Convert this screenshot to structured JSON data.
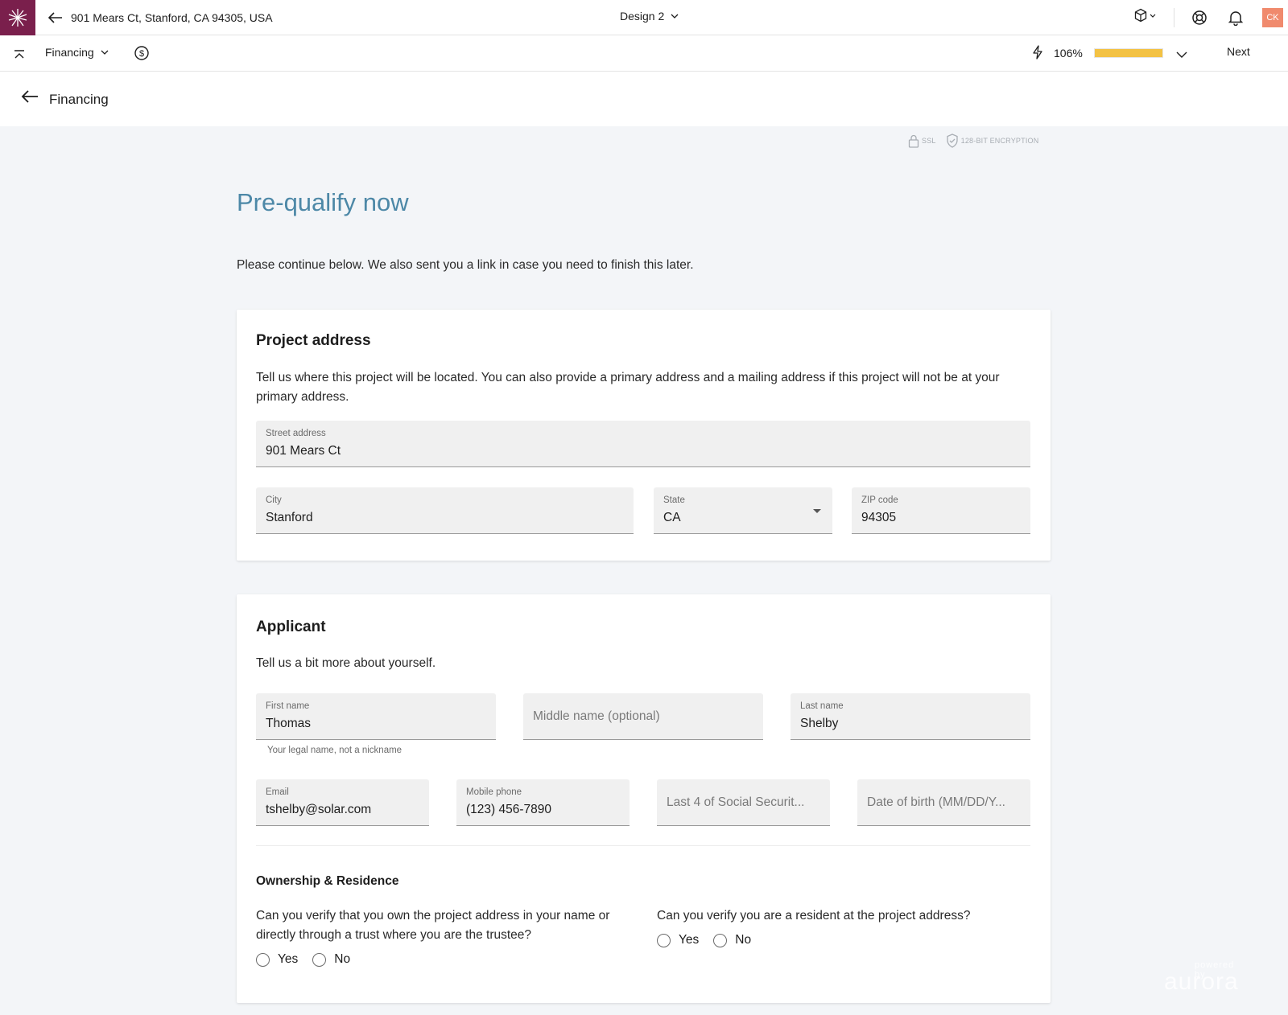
{
  "topbar": {
    "address": "901 Mears Ct, Stanford, CA 94305, USA",
    "design_label": "Design 2",
    "avatar_initials": "CK"
  },
  "subbar": {
    "section_label": "Financing",
    "percent": "106%",
    "progress_fraction": 1.0,
    "next_label": "Next"
  },
  "page_header": {
    "title": "Financing"
  },
  "security": {
    "ssl": "SSL",
    "encryption": "128-BIT ENCRYPTION"
  },
  "main": {
    "title": "Pre-qualify now",
    "intro": "Please continue below. We also sent you a link in case you need to finish this later."
  },
  "project_address": {
    "heading": "Project address",
    "description": "Tell us where this project will be located. You can also provide a primary address and a mailing address if this project will not be at your primary address.",
    "street": {
      "label": "Street address",
      "value": "901 Mears Ct"
    },
    "city": {
      "label": "City",
      "value": "Stanford"
    },
    "state": {
      "label": "State",
      "value": "CA"
    },
    "zip": {
      "label": "ZIP code",
      "value": "94305"
    }
  },
  "applicant": {
    "heading": "Applicant",
    "description": "Tell us a bit more about yourself.",
    "first_name": {
      "label": "First name",
      "value": "Thomas",
      "helper": "Your legal name, not a nickname"
    },
    "middle_name": {
      "placeholder": "Middle name (optional)"
    },
    "last_name": {
      "label": "Last name",
      "value": "Shelby"
    },
    "email": {
      "label": "Email",
      "value": "tshelby@solar.com"
    },
    "phone": {
      "label": "Mobile phone",
      "value": "(123) 456-7890"
    },
    "ssn": {
      "placeholder": "Last 4 of Social Securit..."
    },
    "dob": {
      "placeholder": "Date of birth (MM/DD/Y..."
    },
    "ownership_title": "Ownership & Residence",
    "q_own": "Can you verify that you own the project address in your name or directly through a trust where you are the trustee?",
    "q_resident": "Can you verify you are a resident at the project address?",
    "yes_label": "Yes",
    "no_label": "No"
  },
  "watermark": {
    "small": "powered by",
    "brand": "aurora"
  },
  "colors": {
    "brand": "#7a1f4c",
    "title": "#4d88a7",
    "progress": "#f3c244",
    "avatar": "#f08a6d"
  }
}
